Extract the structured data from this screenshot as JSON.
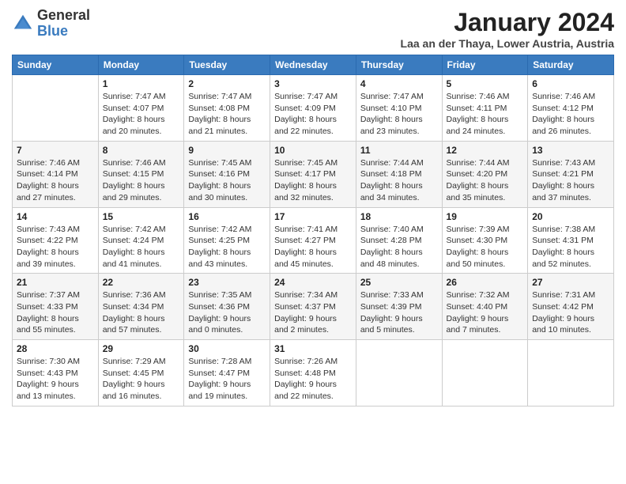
{
  "logo": {
    "general": "General",
    "blue": "Blue"
  },
  "header": {
    "month": "January 2024",
    "location": "Laa an der Thaya, Lower Austria, Austria"
  },
  "days_of_week": [
    "Sunday",
    "Monday",
    "Tuesday",
    "Wednesday",
    "Thursday",
    "Friday",
    "Saturday"
  ],
  "weeks": [
    [
      {
        "day": "",
        "info": ""
      },
      {
        "day": "1",
        "info": "Sunrise: 7:47 AM\nSunset: 4:07 PM\nDaylight: 8 hours\nand 20 minutes."
      },
      {
        "day": "2",
        "info": "Sunrise: 7:47 AM\nSunset: 4:08 PM\nDaylight: 8 hours\nand 21 minutes."
      },
      {
        "day": "3",
        "info": "Sunrise: 7:47 AM\nSunset: 4:09 PM\nDaylight: 8 hours\nand 22 minutes."
      },
      {
        "day": "4",
        "info": "Sunrise: 7:47 AM\nSunset: 4:10 PM\nDaylight: 8 hours\nand 23 minutes."
      },
      {
        "day": "5",
        "info": "Sunrise: 7:46 AM\nSunset: 4:11 PM\nDaylight: 8 hours\nand 24 minutes."
      },
      {
        "day": "6",
        "info": "Sunrise: 7:46 AM\nSunset: 4:12 PM\nDaylight: 8 hours\nand 26 minutes."
      }
    ],
    [
      {
        "day": "7",
        "info": "Sunrise: 7:46 AM\nSunset: 4:14 PM\nDaylight: 8 hours\nand 27 minutes."
      },
      {
        "day": "8",
        "info": "Sunrise: 7:46 AM\nSunset: 4:15 PM\nDaylight: 8 hours\nand 29 minutes."
      },
      {
        "day": "9",
        "info": "Sunrise: 7:45 AM\nSunset: 4:16 PM\nDaylight: 8 hours\nand 30 minutes."
      },
      {
        "day": "10",
        "info": "Sunrise: 7:45 AM\nSunset: 4:17 PM\nDaylight: 8 hours\nand 32 minutes."
      },
      {
        "day": "11",
        "info": "Sunrise: 7:44 AM\nSunset: 4:18 PM\nDaylight: 8 hours\nand 34 minutes."
      },
      {
        "day": "12",
        "info": "Sunrise: 7:44 AM\nSunset: 4:20 PM\nDaylight: 8 hours\nand 35 minutes."
      },
      {
        "day": "13",
        "info": "Sunrise: 7:43 AM\nSunset: 4:21 PM\nDaylight: 8 hours\nand 37 minutes."
      }
    ],
    [
      {
        "day": "14",
        "info": "Sunrise: 7:43 AM\nSunset: 4:22 PM\nDaylight: 8 hours\nand 39 minutes."
      },
      {
        "day": "15",
        "info": "Sunrise: 7:42 AM\nSunset: 4:24 PM\nDaylight: 8 hours\nand 41 minutes."
      },
      {
        "day": "16",
        "info": "Sunrise: 7:42 AM\nSunset: 4:25 PM\nDaylight: 8 hours\nand 43 minutes."
      },
      {
        "day": "17",
        "info": "Sunrise: 7:41 AM\nSunset: 4:27 PM\nDaylight: 8 hours\nand 45 minutes."
      },
      {
        "day": "18",
        "info": "Sunrise: 7:40 AM\nSunset: 4:28 PM\nDaylight: 8 hours\nand 48 minutes."
      },
      {
        "day": "19",
        "info": "Sunrise: 7:39 AM\nSunset: 4:30 PM\nDaylight: 8 hours\nand 50 minutes."
      },
      {
        "day": "20",
        "info": "Sunrise: 7:38 AM\nSunset: 4:31 PM\nDaylight: 8 hours\nand 52 minutes."
      }
    ],
    [
      {
        "day": "21",
        "info": "Sunrise: 7:37 AM\nSunset: 4:33 PM\nDaylight: 8 hours\nand 55 minutes."
      },
      {
        "day": "22",
        "info": "Sunrise: 7:36 AM\nSunset: 4:34 PM\nDaylight: 8 hours\nand 57 minutes."
      },
      {
        "day": "23",
        "info": "Sunrise: 7:35 AM\nSunset: 4:36 PM\nDaylight: 9 hours\nand 0 minutes."
      },
      {
        "day": "24",
        "info": "Sunrise: 7:34 AM\nSunset: 4:37 PM\nDaylight: 9 hours\nand 2 minutes."
      },
      {
        "day": "25",
        "info": "Sunrise: 7:33 AM\nSunset: 4:39 PM\nDaylight: 9 hours\nand 5 minutes."
      },
      {
        "day": "26",
        "info": "Sunrise: 7:32 AM\nSunset: 4:40 PM\nDaylight: 9 hours\nand 7 minutes."
      },
      {
        "day": "27",
        "info": "Sunrise: 7:31 AM\nSunset: 4:42 PM\nDaylight: 9 hours\nand 10 minutes."
      }
    ],
    [
      {
        "day": "28",
        "info": "Sunrise: 7:30 AM\nSunset: 4:43 PM\nDaylight: 9 hours\nand 13 minutes."
      },
      {
        "day": "29",
        "info": "Sunrise: 7:29 AM\nSunset: 4:45 PM\nDaylight: 9 hours\nand 16 minutes."
      },
      {
        "day": "30",
        "info": "Sunrise: 7:28 AM\nSunset: 4:47 PM\nDaylight: 9 hours\nand 19 minutes."
      },
      {
        "day": "31",
        "info": "Sunrise: 7:26 AM\nSunset: 4:48 PM\nDaylight: 9 hours\nand 22 minutes."
      },
      {
        "day": "",
        "info": ""
      },
      {
        "day": "",
        "info": ""
      },
      {
        "day": "",
        "info": ""
      }
    ]
  ]
}
